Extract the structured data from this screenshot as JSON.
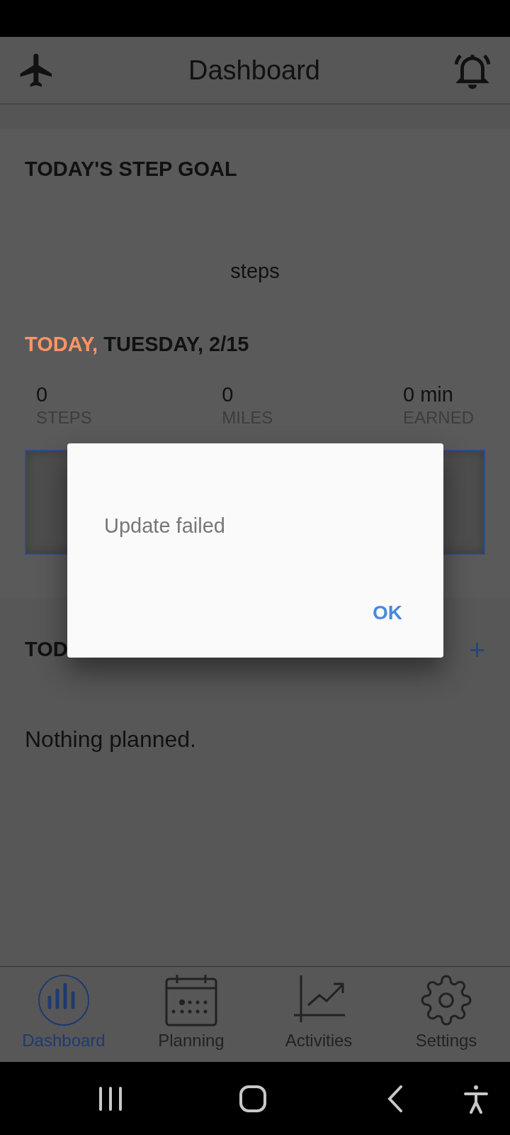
{
  "app_bar": {
    "title": "Dashboard"
  },
  "step_goal": {
    "title": "TODAY'S STEP GOAL",
    "unit": "steps"
  },
  "date": {
    "today": "TODAY,",
    "day": "TUESDAY, 2/15"
  },
  "stats": [
    {
      "value": "0",
      "label": "STEPS"
    },
    {
      "value": "0",
      "label": "MILES"
    },
    {
      "value": "0 min",
      "label": "EARNED"
    }
  ],
  "plan": {
    "title": "TOD",
    "add": "+",
    "empty": "Nothing planned."
  },
  "dialog": {
    "message": "Update failed",
    "button": "OK"
  },
  "nav": [
    {
      "kind": "dashboard",
      "label": "Dashboard",
      "selected": true
    },
    {
      "kind": "planning",
      "label": "Planning",
      "selected": false
    },
    {
      "kind": "activities",
      "label": "Activities",
      "selected": false
    },
    {
      "kind": "settings",
      "label": "Settings",
      "selected": false
    }
  ]
}
